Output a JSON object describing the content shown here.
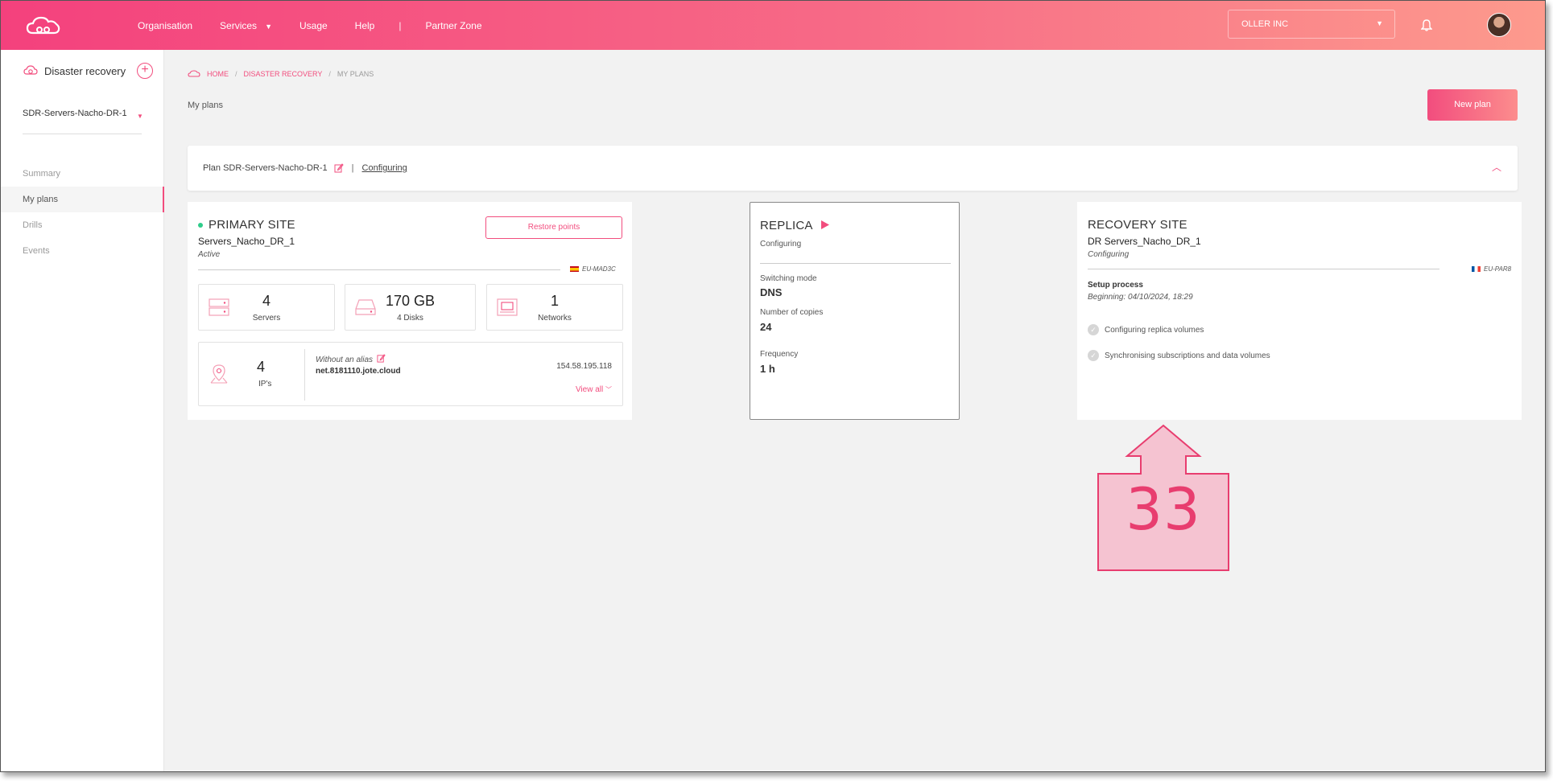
{
  "header": {
    "nav": [
      "Organisation",
      "Services",
      "Usage",
      "Help"
    ],
    "partner_zone": "Partner Zone",
    "org_select": "OLLER INC"
  },
  "sidebar": {
    "title": "Disaster recovery",
    "current_plan": "SDR-Servers-Nacho-DR-1",
    "menu": [
      "Summary",
      "My plans",
      "Drills",
      "Events"
    ],
    "active_menu": "My plans"
  },
  "breadcrumb": [
    "HOME",
    "DISASTER RECOVERY",
    "MY PLANS"
  ],
  "page": {
    "title": "My plans",
    "new_plan_button": "New plan"
  },
  "plan": {
    "name": "Plan SDR-Servers-Nacho-DR-1",
    "status": "Configuring"
  },
  "primary_site": {
    "title": "PRIMARY SITE",
    "name": "Servers_Nacho_DR_1",
    "status": "Active",
    "restore_button": "Restore points",
    "region": "EU-MAD3C",
    "metrics": [
      {
        "value": "4",
        "label": "Servers"
      },
      {
        "value": "170 GB",
        "label": "4 Disks"
      },
      {
        "value": "1",
        "label": "Networks"
      }
    ],
    "ips": {
      "value": "4",
      "label": "IP's",
      "alias": "Without an alias",
      "host": "net.8181110.jote.cloud",
      "address": "154.58.195.118",
      "view_all": "View all"
    }
  },
  "replica": {
    "title": "REPLICA",
    "status": "Configuring",
    "fields": [
      {
        "label": "Switching mode",
        "value": "DNS"
      },
      {
        "label": "Number of copies",
        "value": "24"
      },
      {
        "label": "Frequency",
        "value": "1 h"
      }
    ]
  },
  "recovery_site": {
    "title": "RECOVERY SITE",
    "name": "DR Servers_Nacho_DR_1",
    "status": "Configuring",
    "region": "EU-PAR8",
    "setup_title": "Setup process",
    "setup_beginning": "Beginning: 04/10/2024, 18:29",
    "steps": [
      "Configuring replica volumes",
      "Synchronising subscriptions and data volumes"
    ]
  },
  "callout": {
    "number": "33",
    "color": "#e83d6f"
  },
  "colors": {
    "accent": "#f24d7e",
    "header_gradient_start": "#f4417d",
    "header_gradient_end": "#fd9a8d",
    "active_green": "#2ecc8a"
  }
}
